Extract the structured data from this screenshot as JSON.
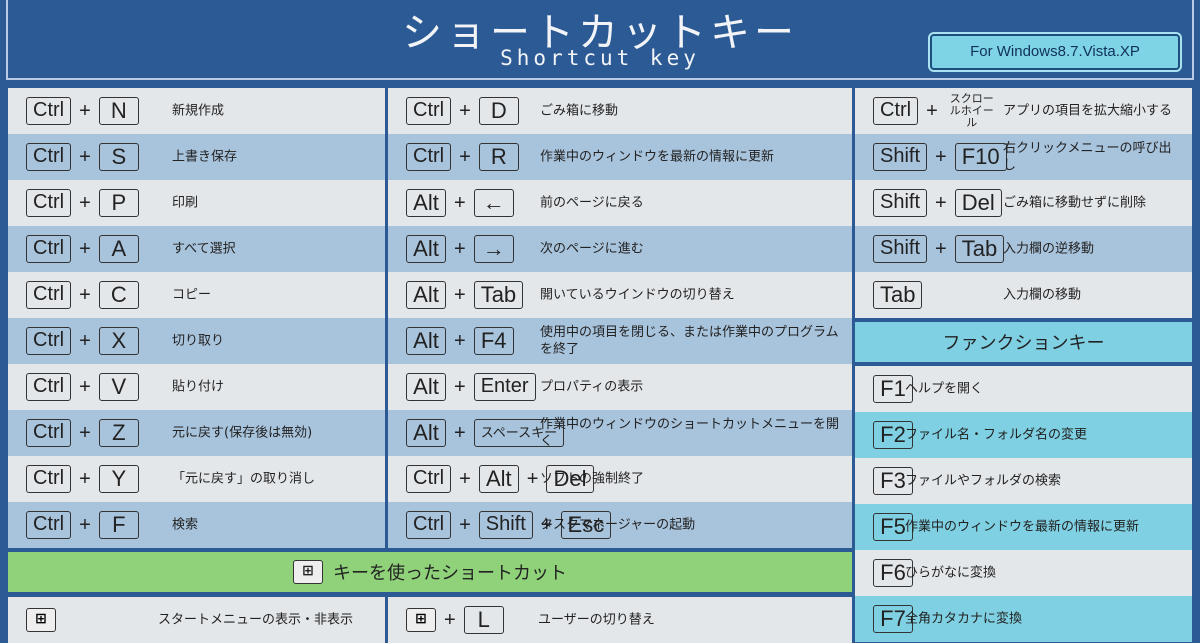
{
  "header": {
    "title": "ショートカットキー",
    "subtitle": "Shortcut key",
    "badge": "For Windows8.7.Vista.XP"
  },
  "columns": [
    {
      "rows": [
        {
          "keys": [
            "Ctrl",
            "N"
          ],
          "desc": "新規作成"
        },
        {
          "keys": [
            "Ctrl",
            "S"
          ],
          "desc": "上書き保存"
        },
        {
          "keys": [
            "Ctrl",
            "P"
          ],
          "desc": "印刷"
        },
        {
          "keys": [
            "Ctrl",
            "A"
          ],
          "desc": "すべて選択"
        },
        {
          "keys": [
            "Ctrl",
            "C"
          ],
          "desc": "コピー"
        },
        {
          "keys": [
            "Ctrl",
            "X"
          ],
          "desc": "切り取り"
        },
        {
          "keys": [
            "Ctrl",
            "V"
          ],
          "desc": "貼り付け"
        },
        {
          "keys": [
            "Ctrl",
            "Z"
          ],
          "desc": "元に戻す(保存後は無効)"
        },
        {
          "keys": [
            "Ctrl",
            "Y"
          ],
          "desc": "「元に戻す」の取り消し"
        },
        {
          "keys": [
            "Ctrl",
            "F"
          ],
          "desc": "検索"
        }
      ]
    },
    {
      "rows": [
        {
          "keys": [
            "Ctrl",
            "D"
          ],
          "desc": "ごみ箱に移動"
        },
        {
          "keys": [
            "Ctrl",
            "R"
          ],
          "desc": "作業中のウィンドウを最新の情報に更新"
        },
        {
          "keys": [
            "Alt",
            "←"
          ],
          "desc": "前のページに戻る"
        },
        {
          "keys": [
            "Alt",
            "→"
          ],
          "desc": "次のページに進む"
        },
        {
          "keys": [
            "Alt",
            "Tab"
          ],
          "desc": "開いているウインドウの切り替え"
        },
        {
          "keys": [
            "Alt",
            "F4"
          ],
          "desc": "使用中の項目を閉じる、または作業中のプログラムを終了"
        },
        {
          "keys": [
            "Alt",
            "Enter"
          ],
          "desc": "プロパティの表示"
        },
        {
          "keys": [
            "Alt",
            "スペースキー"
          ],
          "desc": "作業中のウィンドウのショートカットメニューを開く"
        },
        {
          "keys": [
            "Ctrl",
            "Alt",
            "Del"
          ],
          "desc": "ソフトの強制終了"
        },
        {
          "keys": [
            "Ctrl",
            "Shift",
            "Esc"
          ],
          "desc": "タスクマネージャーの起動"
        }
      ]
    },
    {
      "rows": [
        {
          "keys": [
            "Ctrl"
          ],
          "wheel": "スクロールホイール",
          "desc": "アプリの項目を拡大縮小する"
        },
        {
          "keys": [
            "Shift",
            "F10"
          ],
          "desc": "右クリックメニューの呼び出し"
        },
        {
          "keys": [
            "Shift",
            "Del"
          ],
          "desc": "ごみ箱に移動せずに削除"
        },
        {
          "keys": [
            "Shift",
            "Tab"
          ],
          "desc": "入力欄の逆移動"
        },
        {
          "keys": [
            "Tab"
          ],
          "desc": "入力欄の移動"
        }
      ]
    }
  ],
  "function_keys": {
    "title": "ファンクションキー",
    "rows": [
      {
        "keys": [
          "F1"
        ],
        "desc": "ヘルプを開く"
      },
      {
        "keys": [
          "F2"
        ],
        "desc": "ファイル名・フォルダ名の変更"
      },
      {
        "keys": [
          "F3"
        ],
        "desc": "ファイルやフォルダの検索"
      },
      {
        "keys": [
          "F5"
        ],
        "desc": "作業中のウィンドウを最新の情報に更新"
      },
      {
        "keys": [
          "F6"
        ],
        "desc": "ひらがなに変換"
      },
      {
        "keys": [
          "F7"
        ],
        "desc": "全角カタカナに変換"
      }
    ]
  },
  "windows_key": {
    "title": "キーを使ったショートカット",
    "rows": [
      {
        "keys": [
          "win"
        ],
        "desc": "スタートメニューの表示・非表示"
      },
      {
        "keys": [
          "win",
          "L"
        ],
        "desc": "ユーザーの切り替え"
      }
    ]
  },
  "colors": {
    "background": "#2c5a94",
    "row_light": "#e4e7ea",
    "row_blue": "#a8c3dc",
    "row_cyan": "#7fd0e2",
    "green_header": "#8fd27a"
  }
}
